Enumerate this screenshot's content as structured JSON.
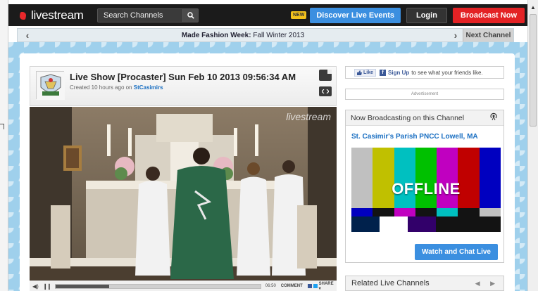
{
  "topbar": {
    "logo_text": "livestream",
    "search_placeholder": "Search Channels",
    "new_badge": "NEW",
    "discover_label": "Discover Live Events",
    "login_label": "Login",
    "broadcast_label": "Broadcast Now"
  },
  "channel_bar": {
    "prev": "‹",
    "title_bold": "Made Fashion Week:",
    "title_light": " Fall Winter 2013",
    "next_arrow": "›",
    "next_label": "Next Channel"
  },
  "show": {
    "title": "Live Show [Procaster] Sun Feb 10 2013 09:56:34 AM",
    "created_prefix": "Created 10 hours ago on ",
    "channel_link": "StCasimirs",
    "watermark": "livestream"
  },
  "player": {
    "time": "06:50",
    "comment_label": "COMMENT",
    "share_label": "SHARE ▾",
    "progress_fraction": 0.26
  },
  "sidebar": {
    "fb_like": "Like",
    "fb_signup": "Sign Up",
    "fb_text": "to see what your friends like.",
    "ad_label": "Advertisement",
    "now_title": "Now Broadcasting on this Channel",
    "channel_name": "St. Casimir's Parish PNCC Lowell, MA",
    "offline_text": "OFFLINE",
    "watch_label": "Watch and Chat Live",
    "related_title": "Related Live Channels",
    "pager": "◀ ▶"
  },
  "colors": {
    "accent_blue": "#3b8fe0",
    "brand_red": "#e32225",
    "link_blue": "#1a6fc2",
    "page_bg": "#9fd0ec"
  },
  "icons": [
    "search-icon",
    "new-window-icon",
    "embed-icon",
    "volume-icon",
    "pause-icon",
    "broadcast-signal-icon",
    "facebook-icon"
  ]
}
